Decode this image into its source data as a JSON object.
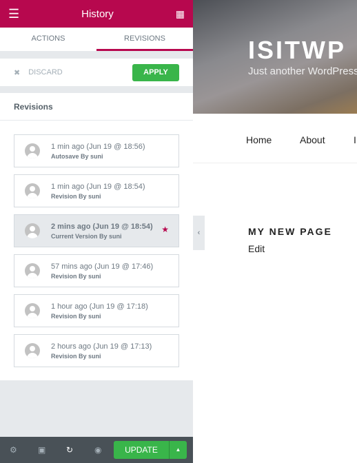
{
  "panel": {
    "title": "History",
    "tabs": [
      "ACTIONS",
      "REVISIONS"
    ],
    "active_tab": "REVISIONS",
    "discard": "DISCARD",
    "apply": "APPLY",
    "section_title": "Revisions",
    "revisions": [
      {
        "date": "1 min ago (Jun 19 @ 18:56)",
        "author": "Autosave By suni",
        "current": false
      },
      {
        "date": "1 min ago (Jun 19 @ 18:54)",
        "author": "Revision By suni",
        "current": false
      },
      {
        "date": "2 mins ago (Jun 19 @ 18:54)",
        "author": "Current Version By suni",
        "current": true
      },
      {
        "date": "57 mins ago (Jun 19 @ 17:46)",
        "author": "Revision By suni",
        "current": false
      },
      {
        "date": "1 hour ago (Jun 19 @ 17:18)",
        "author": "Revision By suni",
        "current": false
      },
      {
        "date": "2 hours ago (Jun 19 @ 17:13)",
        "author": "Revision By suni",
        "current": false
      }
    ],
    "update": "UPDATE"
  },
  "site": {
    "title": "ISITWP",
    "tagline": "Just another WordPress",
    "nav": [
      "Home",
      "About",
      "I"
    ],
    "page_title": "MY NEW PAGE",
    "edit": "Edit"
  },
  "colors": {
    "brand": "#b7084e",
    "success": "#39b54a",
    "footer": "#495157"
  }
}
